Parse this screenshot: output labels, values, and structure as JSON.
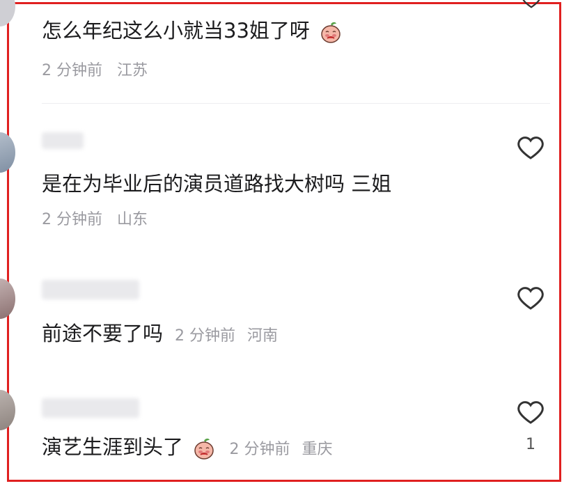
{
  "comments": [
    {
      "text": "怎么年纪这么小就当33姐了呀",
      "meta": "2 分钟前",
      "location": "江苏",
      "emoji": "peach-cry-icon"
    },
    {
      "text": "是在为毕业后的演员道路找大树吗 三姐",
      "meta": "2 分钟前",
      "location": "山东"
    },
    {
      "text": "前途不要了吗",
      "meta": "2 分钟前",
      "location": "河南"
    },
    {
      "text": "演艺生涯到头了",
      "meta": "2 分钟前",
      "location": "重庆",
      "emoji": "peach-cry-icon",
      "likes": "1"
    }
  ],
  "colors": {
    "frame": "#e02020",
    "text": "#1c1c1e",
    "meta": "#9a9aa0"
  }
}
